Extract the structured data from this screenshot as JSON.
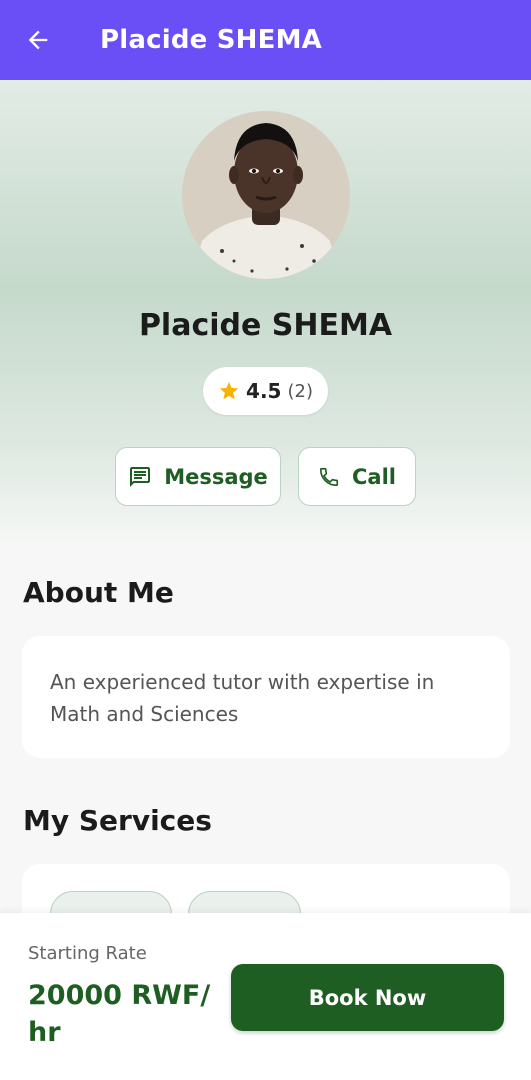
{
  "header": {
    "title": "Placide SHEMA",
    "back_icon": "arrow-left-icon"
  },
  "profile": {
    "name": "Placide SHEMA",
    "rating": {
      "value": "4.5",
      "count": "(2)",
      "icon": "star-icon",
      "star_color": "#f5b400"
    }
  },
  "actions": {
    "message": {
      "label": "Message",
      "icon": "message-icon"
    },
    "call": {
      "label": "Call",
      "icon": "phone-icon"
    }
  },
  "about": {
    "title": "About Me",
    "text": "An experienced tutor with expertise in Math and Sciences"
  },
  "services": {
    "title": "My Services"
  },
  "booking": {
    "rate_label": "Starting Rate",
    "rate_value": "20000 RWF/ hr",
    "book_label": "Book Now"
  },
  "colors": {
    "app_bar": "#6a4ef6",
    "accent_green": "#1f5e23"
  }
}
